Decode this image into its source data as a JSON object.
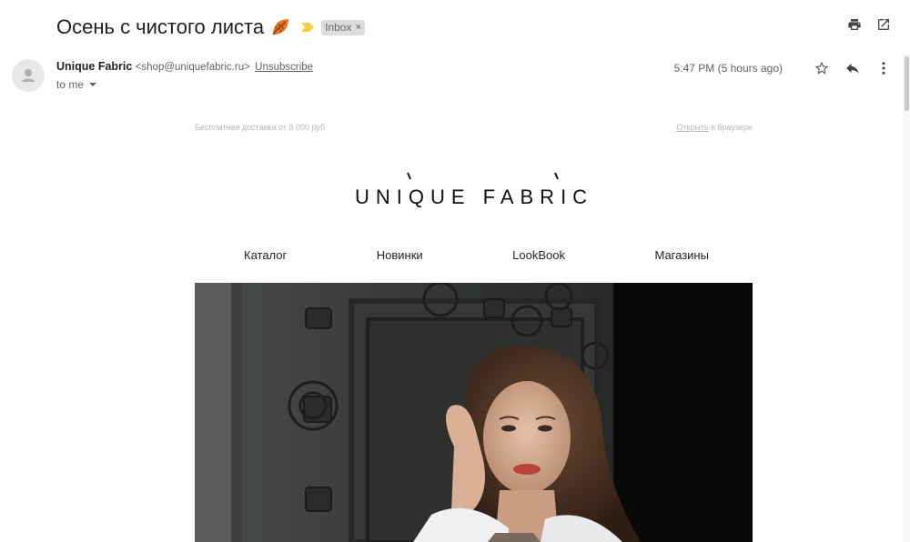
{
  "email": {
    "subject": "Осень с чистого листа",
    "label": "Inbox",
    "label_remove": "×"
  },
  "sender": {
    "name": "Unique Fabric",
    "email": "<shop@uniquefabric.ru>",
    "unsubscribe": "Unsubscribe",
    "recipient": "to me",
    "timestamp": "5:47 PM (5 hours ago)"
  },
  "icons": {
    "subject_emoji": "fallen-leaf-icon",
    "importance": "importance-marker-icon",
    "print": "print-icon",
    "open_new_window": "open-in-new-window-icon",
    "star": "star-icon",
    "reply": "reply-icon",
    "more": "more-vertical-icon",
    "avatar": "default-avatar-icon"
  },
  "body": {
    "preheader_left": "Бесплатная доставка от 8 000 руб",
    "preheader_open": "Открыть",
    "preheader_browser": " в браузере",
    "logo_text": "UNIQUE FABRIC",
    "nav": [
      "Каталог",
      "Новинки",
      "LookBook",
      "Магазины"
    ]
  },
  "colors": {
    "importance": "#f4d03f",
    "leaf": "#e67e22",
    "label_bg": "#dddddd"
  }
}
